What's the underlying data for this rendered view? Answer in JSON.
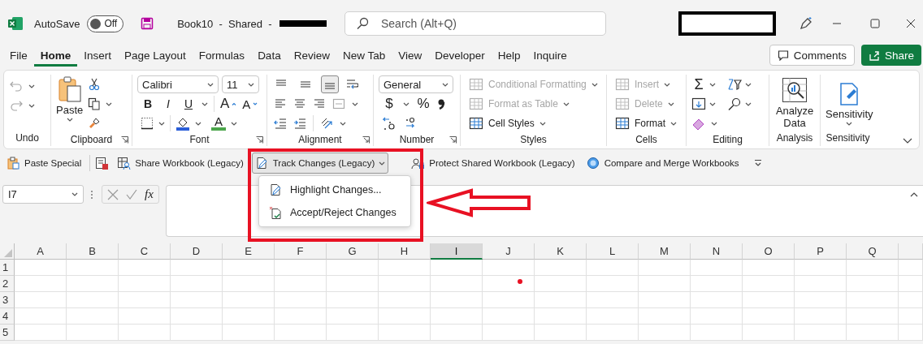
{
  "title_bar": {
    "autosave_label": "AutoSave",
    "autosave": {
      "label": "Off",
      "on": false
    },
    "document_title": "Book10  -  Shared  -",
    "search_placeholder": "Search (Alt+Q)"
  },
  "tabs": [
    {
      "label": "File",
      "selected": false
    },
    {
      "label": "Home",
      "selected": true
    },
    {
      "label": "Insert",
      "selected": false
    },
    {
      "label": "Page Layout",
      "selected": false
    },
    {
      "label": "Formulas",
      "selected": false
    },
    {
      "label": "Data",
      "selected": false
    },
    {
      "label": "Review",
      "selected": false
    },
    {
      "label": "New Tab",
      "selected": false
    },
    {
      "label": "View",
      "selected": false
    },
    {
      "label": "Developer",
      "selected": false
    },
    {
      "label": "Help",
      "selected": false
    },
    {
      "label": "Inquire",
      "selected": false
    }
  ],
  "header_buttons": [
    {
      "label": "Comments",
      "kind": "outline"
    },
    {
      "label": "Share",
      "kind": "primary"
    }
  ],
  "ribbon": {
    "groups": [
      {
        "label": "Undo"
      },
      {
        "label": "Clipboard",
        "paste": "Paste"
      },
      {
        "label": "Font",
        "font_name": "Calibri",
        "font_size": "11",
        "style_buttons": [
          "B",
          "I",
          "U"
        ],
        "grow_font": "A",
        "shrink_font": "A",
        "font_color": "A"
      },
      {
        "label": "Alignment",
        "vertical_align": [
          {
            "selected": false
          },
          {
            "selected": false
          },
          {
            "selected": true
          }
        ]
      },
      {
        "label": "Number",
        "number_format": "General",
        "currency": "$",
        "percent": "%"
      },
      {
        "label": "Styles",
        "commands": [
          {
            "label": "Conditional Formatting",
            "disabled": true
          },
          {
            "label": "Format as Table",
            "disabled": true
          },
          {
            "label": "Cell Styles",
            "disabled": false
          }
        ]
      },
      {
        "label": "Cells",
        "commands": [
          {
            "label": "Insert",
            "disabled": true
          },
          {
            "label": "Delete",
            "disabled": true
          },
          {
            "label": "Format",
            "disabled": false
          }
        ]
      },
      {
        "label": "Editing",
        "autosum": "Σ"
      },
      {
        "label": "Analysis",
        "command": "Analyze Data"
      },
      {
        "label": "Sensitivity",
        "command": "Sensitivity"
      }
    ]
  },
  "quick_access": [
    {
      "label": "Paste Special",
      "kind": "command",
      "expanded": false
    },
    {
      "label": "Share Workbook (Legacy)",
      "kind": "command",
      "expanded": false
    },
    {
      "label": "Track Changes (Legacy)",
      "kind": "dropdown",
      "expanded": true
    },
    {
      "label": "Protect Shared Workbook (Legacy)",
      "kind": "command",
      "expanded": false
    },
    {
      "label": "Compare and Merge Workbooks",
      "kind": "command",
      "expanded": false
    }
  ],
  "track_changes_menu": [
    {
      "label": "Highlight Changes..."
    },
    {
      "label": "Accept/Reject Changes"
    }
  ],
  "formula_bar": {
    "name_box": "I7",
    "function_label": "fx"
  },
  "sheet": {
    "columns": [
      {
        "label": "A",
        "selected": false
      },
      {
        "label": "B",
        "selected": false
      },
      {
        "label": "C",
        "selected": false
      },
      {
        "label": "D",
        "selected": false
      },
      {
        "label": "E",
        "selected": false
      },
      {
        "label": "F",
        "selected": false
      },
      {
        "label": "G",
        "selected": false
      },
      {
        "label": "H",
        "selected": false
      },
      {
        "label": "I",
        "selected": true
      },
      {
        "label": "J",
        "selected": false
      },
      {
        "label": "K",
        "selected": false
      },
      {
        "label": "L",
        "selected": false
      },
      {
        "label": "M",
        "selected": false
      },
      {
        "label": "N",
        "selected": false
      },
      {
        "label": "O",
        "selected": false
      },
      {
        "label": "P",
        "selected": false
      },
      {
        "label": "Q",
        "selected": false
      }
    ],
    "rows": [
      "1",
      "2",
      "3",
      "4",
      "5"
    ]
  }
}
